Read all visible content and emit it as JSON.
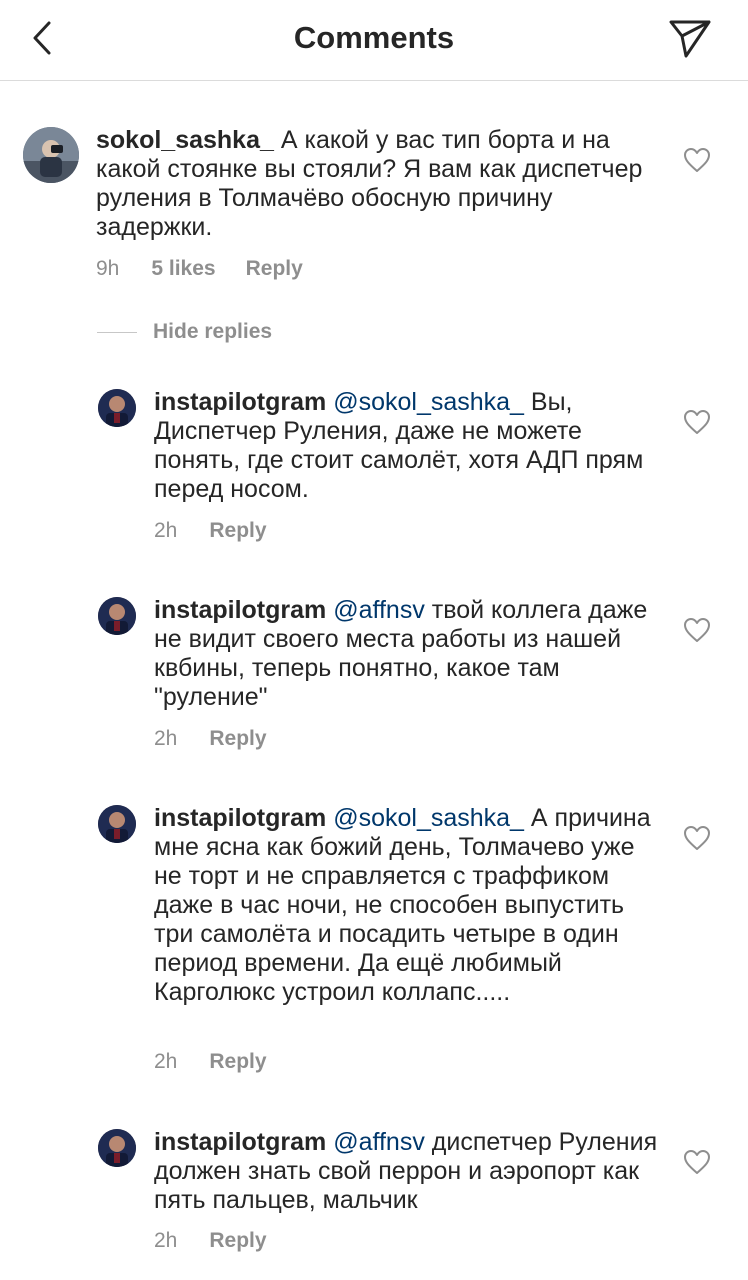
{
  "header": {
    "title": "Comments",
    "back_icon": "chevron-left-icon",
    "share_icon": "paper-plane-icon"
  },
  "main_comment": {
    "username": "sokol_sashka_",
    "text": "А какой у вас тип борта и на какой стоянке вы стояли? Я вам как диспетчер руления в Толмачёво обосную причину задержки.",
    "time": "9h",
    "likes": "5 likes",
    "reply_label": "Reply"
  },
  "hide_replies_label": "Hide replies",
  "replies": [
    {
      "username": "instapilotgram",
      "mention": "@sokol_sashka_",
      "text": "  Вы, Диспетчер Руления, даже не можете понять, где стоит самолёт, хотя АДП прям перед носом.",
      "time": "2h",
      "reply_label": "Reply"
    },
    {
      "username": "instapilotgram",
      "mention": "@affnsv",
      "text": " твой коллега даже не видит своего места работы из нашей квбины, теперь понятно, какое там \"руление\"",
      "time": "2h",
      "reply_label": "Reply"
    },
    {
      "username": "instapilotgram",
      "mention": "@sokol_sashka_",
      "text": " А причина мне ясна как божий день, Толмачево уже не торт и не справляется с траффиком даже в час ночи, не способен выпустить три самолёта и посадить четыре в один период времени. Да ещё любимый Карголюкс устроил коллапс.....",
      "time": "2h",
      "reply_label": "Reply"
    },
    {
      "username": "instapilotgram",
      "mention": "@affnsv",
      "text": " диспетчер Руления должен знать свой перрон и аэропорт как пять пальцев, мальчик",
      "time": "2h",
      "reply_label": "Reply"
    }
  ],
  "colors": {
    "text": "#262626",
    "secondary": "#8e8e8e",
    "mention": "#00376b",
    "divider": "#dbdbdb"
  }
}
